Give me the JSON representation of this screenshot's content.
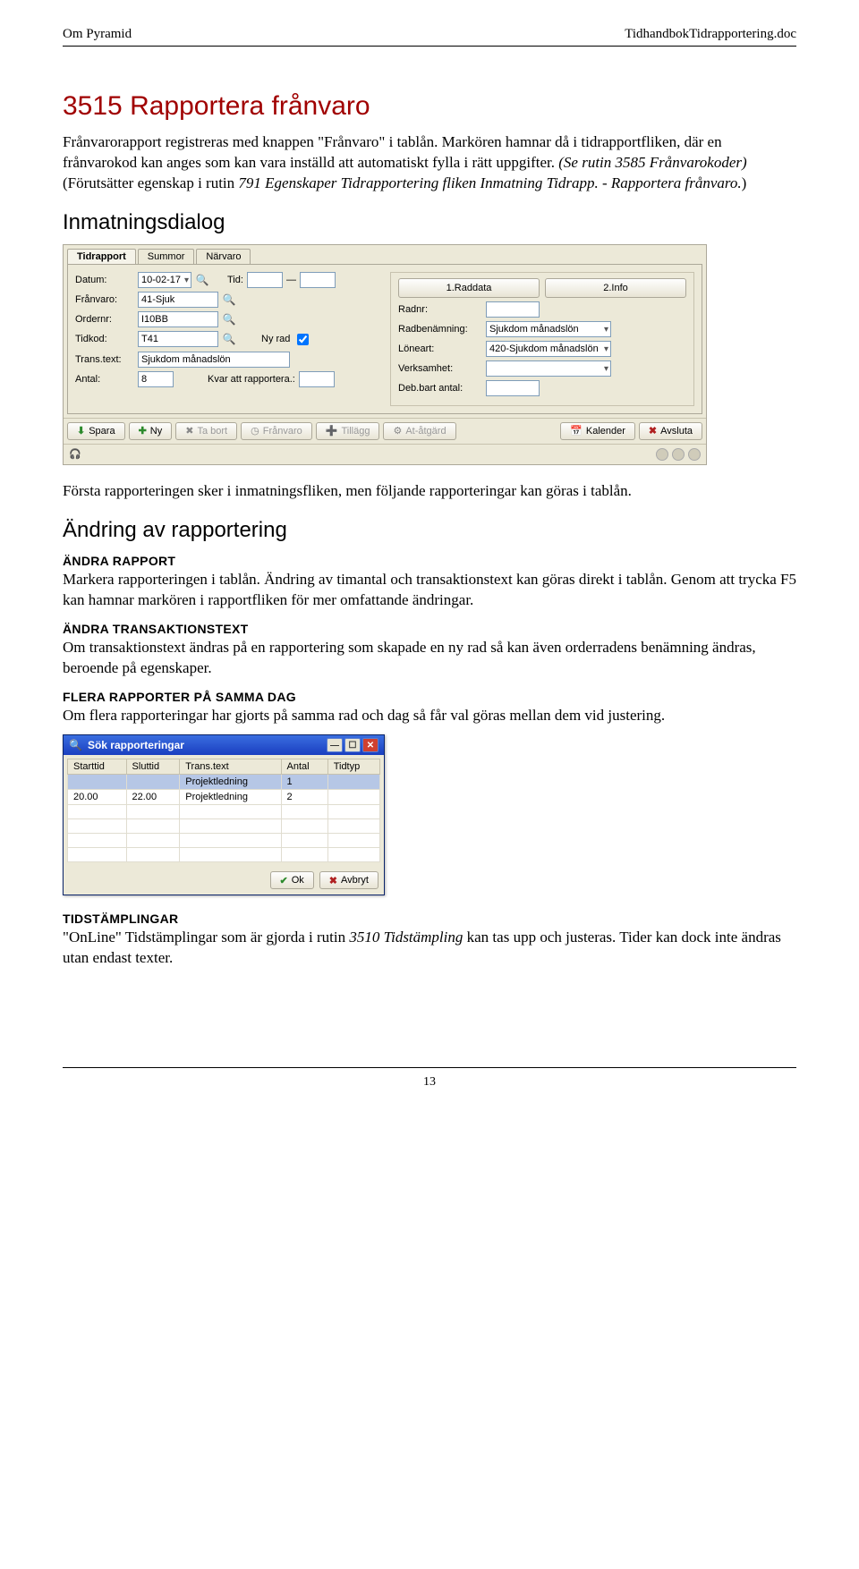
{
  "header": {
    "left": "Om Pyramid",
    "right": "TidhandbokTidrapportering.doc"
  },
  "h1": "3515 Rapportera frånvaro",
  "intro_parts": {
    "a": "Frånvarorapport registreras med knappen \"Frånvaro\" i tablån. Markören hamnar då i tidrapportfliken, där en frånvarokod kan anges som kan vara inställd att automatiskt fylla i rätt uppgifter. ",
    "b": "(Se rutin 3585 Frånvarokoder)",
    "c": " (Förutsätter egenskap i rutin ",
    "d": "791 Egenskaper Tidrapportering fliken Inmatning Tidrapp. - Rapportera frånvaro.",
    "e": ")"
  },
  "h2_inmatning": "Inmatningsdialog",
  "dialog1": {
    "tabs": [
      "Tidrapport",
      "Summor",
      "Närvaro"
    ],
    "left": {
      "labels": {
        "datum": "Datum:",
        "tid": "Tid:",
        "franvaro": "Frånvaro:",
        "ordernr": "Ordernr:",
        "tidkod": "Tidkod:",
        "nyrad": "Ny rad",
        "transtext": "Trans.text:",
        "antal": "Antal:",
        "kvar": "Kvar att rapportera.:"
      },
      "values": {
        "datum": "10-02-17",
        "franvaro": "41-Sjuk",
        "ordernr": "I10BB",
        "tidkod": "T41",
        "transtext": "Sjukdom månadslön",
        "antal": "8"
      }
    },
    "right": {
      "buttons": {
        "raddata": "1.Raddata",
        "info": "2.Info"
      },
      "labels": {
        "radnr": "Radnr:",
        "radbenamning": "Radbenämning:",
        "loneart": "Löneart:",
        "verksamhet": "Verksamhet:",
        "debant": "Deb.bart antal:"
      },
      "values": {
        "radbenamning": "Sjukdom månadslön",
        "loneart": "420-Sjukdom månadslön"
      }
    },
    "toolbar": {
      "spara": "Spara",
      "ny": "Ny",
      "tabort": "Ta bort",
      "franvaro": "Frånvaro",
      "tillagg": "Tillägg",
      "atgard": "At-åtgärd",
      "kalender": "Kalender",
      "avsluta": "Avsluta"
    }
  },
  "after_dialog1": "Första rapporteringen sker i inmatningsfliken, men följande rapporteringar kan göras i tablån.",
  "h2_andring": "Ändring av rapportering",
  "andra_rapport_h": "ÄNDRA RAPPORT",
  "andra_rapport_p": "Markera rapporteringen i tablån. Ändring av timantal och transaktionstext kan göras direkt i tablån. Genom att trycka F5 kan hamnar markören i rapportfliken för mer omfattande ändringar.",
  "andra_trans_h": "ÄNDRA TRANSAKTIONSTEXT",
  "andra_trans_p": "Om transaktionstext ändras på en rapportering som skapade en ny rad så kan även orderradens benämning ändras, beroende på egenskaper.",
  "flera_h": "FLERA RAPPORTER PÅ SAMMA DAG",
  "flera_p": "Om flera rapporteringar har gjorts på samma rad och dag så får val göras mellan dem vid justering.",
  "dialog2": {
    "title": "Sök rapporteringar",
    "headers": [
      "Starttid",
      "Sluttid",
      "Trans.text",
      "Antal",
      "Tidtyp"
    ],
    "rows": [
      {
        "start": "",
        "slut": "",
        "text": "Projektledning",
        "antal": "1",
        "tidtyp": "",
        "sel": true
      },
      {
        "start": "20.00",
        "slut": "22.00",
        "text": "Projektledning",
        "antal": "2",
        "tidtyp": "",
        "sel": false
      }
    ],
    "ok": "Ok",
    "avbryt": "Avbryt"
  },
  "tidst_h": "TIDSTÄMPLINGAR",
  "tidst_p_parts": {
    "a": "\"OnLine\" Tidstämplingar som är gjorda i rutin ",
    "b": "3510 Tidstämpling",
    "c": " kan tas upp och justeras. Tider kan dock inte ändras utan endast texter."
  },
  "page_num": "13"
}
